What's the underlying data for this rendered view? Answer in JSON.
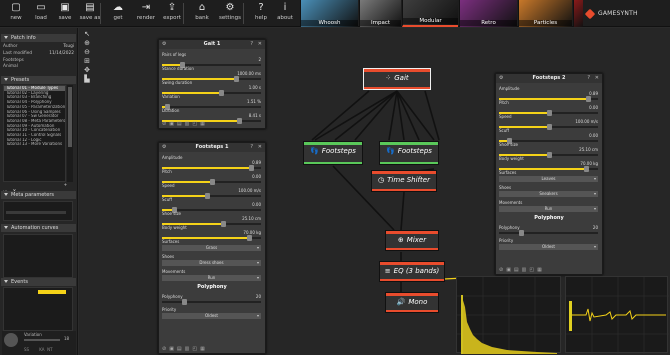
{
  "toolbar": {
    "buttons": [
      {
        "label": "new",
        "icon": "new-file-icon",
        "glyph": "▢"
      },
      {
        "label": "load",
        "icon": "folder-open-icon",
        "glyph": "▭"
      },
      {
        "label": "save",
        "icon": "save-disk-icon",
        "glyph": "▣"
      },
      {
        "label": "save as",
        "icon": "save-as-icon",
        "glyph": "▤"
      },
      {
        "label": "get",
        "icon": "cloud-download-icon",
        "glyph": "☁"
      },
      {
        "label": "render",
        "icon": "render-icon",
        "glyph": "⇥"
      },
      {
        "label": "export",
        "icon": "export-icon",
        "glyph": "⇪"
      },
      {
        "label": "bank",
        "icon": "bank-icon",
        "glyph": "⌂"
      },
      {
        "label": "settings",
        "icon": "gear-icon",
        "glyph": "⚙"
      },
      {
        "label": "help",
        "icon": "help-icon",
        "glyph": "?"
      },
      {
        "label": "about",
        "icon": "info-icon",
        "glyph": "i"
      }
    ],
    "models": [
      {
        "label": "Whoosh",
        "color": "#4a8fb8"
      },
      {
        "label": "Impact",
        "color": "#7a7a7a"
      },
      {
        "label": "Modular",
        "color": "#3e3e3e"
      },
      {
        "label": "Retro",
        "color": "#7b2f7f"
      },
      {
        "label": "Particles",
        "color": "#c8782a"
      },
      {
        "label": "",
        "color": "#8b1a1a"
      }
    ],
    "logo": "GAMESYNTH"
  },
  "left_panel": {
    "patch_info": {
      "title": "Patch info",
      "rows": [
        {
          "label": "Author",
          "value": "Tsugi"
        },
        {
          "label": "Last modified",
          "value": "11/14/2022"
        },
        {
          "label": "Footsteps",
          "value": ""
        },
        {
          "label": "Animal",
          "value": ""
        }
      ]
    },
    "presets": {
      "title": "Presets",
      "items": [
        "Tutorial 01 - Module Types",
        "Tutorial 02 - Layering",
        "Tutorial 03 - Branching",
        "Tutorial 04 - Polyphony",
        "Tutorial 05 - Parameterization",
        "Tutorial 06 - Using Samples",
        "Tutorial 07 - Sw Generator",
        "Tutorial 08 - Meta Parameters",
        "Tutorial 09 - Automation",
        "Tutorial 10 - Concatenation",
        "Tutorial 11 - Control Signals",
        "Tutorial 12 - Logic",
        "Tutorial 13 - More Variations"
      ],
      "selected_index": 0
    },
    "meta_parameters": {
      "title": "Meta parameters"
    },
    "automation_curves": {
      "title": "Automation curves"
    },
    "events": {
      "title": "Events"
    },
    "footer": {
      "variation": "Variation",
      "zoom": "18",
      "ss": "SS",
      "ka": "KA",
      "nt": "NT"
    }
  },
  "gait_panel": {
    "title": "Gait 1",
    "params": [
      {
        "label": "Pairs of legs",
        "value": "2",
        "level": 0.2
      },
      {
        "label": "Stance duration",
        "value": "1000.00 ms",
        "level": 0.75
      },
      {
        "label": "Swing duration",
        "value": "1.00 s",
        "level": 0.6
      },
      {
        "label": "Variation",
        "value": "1.51 %",
        "level": 0.05
      },
      {
        "label": "Duration",
        "value": "8.41 s",
        "level": 0.78
      }
    ]
  },
  "footsteps1_panel": {
    "title": "Footsteps 1",
    "params": [
      {
        "label": "Amplitude",
        "value": "0.89",
        "level": 0.9
      },
      {
        "label": "Pitch",
        "value": "0.00",
        "level": 0.5
      },
      {
        "label": "Speed",
        "value": "100.00 m/s",
        "level": 0.45
      },
      {
        "label": "Scuff",
        "value": "0.00",
        "level": 0.12
      },
      {
        "label": "Shoe size",
        "value": "25.10 cm",
        "level": 0.62
      },
      {
        "label": "Body weight",
        "value": "70.00 kg",
        "level": 0.88
      }
    ],
    "surfaces_label": "Surfaces",
    "surfaces_value": "Grass",
    "shoes_label": "Shoes",
    "shoes_value": "Dress shoes",
    "movements_label": "Movements",
    "movements_value": "Run",
    "polyphony_title": "Polyphony",
    "polyphony_label": "Polyphony",
    "polyphony_value": "20",
    "priority_label": "Priority",
    "priority_value": "Oldest"
  },
  "footsteps2_panel": {
    "title": "Footsteps 2",
    "params": [
      {
        "label": "Amplitude",
        "value": "0.89",
        "level": 0.9
      },
      {
        "label": "Pitch",
        "value": "0.00",
        "level": 0.5
      },
      {
        "label": "Speed",
        "value": "100.00 m/s",
        "level": 0.5
      },
      {
        "label": "Scuff",
        "value": "0.00",
        "level": 0.1
      },
      {
        "label": "Shoe size",
        "value": "25.10 cm",
        "level": 0.5
      },
      {
        "label": "Body weight",
        "value": "70.00 kg",
        "level": 0.88
      }
    ],
    "surfaces_label": "Surfaces",
    "surfaces_value": "Leaves",
    "shoes_label": "Shoes",
    "shoes_value": "Sneakers",
    "movements_label": "Movements",
    "movements_value": "Run",
    "polyphony_title": "Polyphony",
    "polyphony_label": "Polyphony",
    "polyphony_value": "20",
    "priority_label": "Priority",
    "priority_value": "Oldest"
  },
  "nodes": {
    "gait": {
      "label": "Gait",
      "glyph": "⁘",
      "color": "#e94c2d"
    },
    "footsteps_a": {
      "label": "Footsteps",
      "glyph": "👣",
      "color": "#5ac85a"
    },
    "footsteps_b": {
      "label": "Footsteps",
      "glyph": "👣",
      "color": "#5ac85a"
    },
    "time_shifter": {
      "label": "Time Shifter",
      "glyph": "◷",
      "color": "#e94c2d"
    },
    "mixer": {
      "label": "Mixer",
      "glyph": "⊕",
      "color": "#e94c2d"
    },
    "eq": {
      "label": "EQ (3 bands)",
      "glyph": "≡",
      "color": "#e94c2d"
    },
    "mono": {
      "label": "Mono",
      "glyph": "🔊",
      "color": "#e94c2d"
    }
  },
  "colors": {
    "accent": "#e94c2d",
    "slider": "#f5d218",
    "generator": "#5ac85a"
  }
}
